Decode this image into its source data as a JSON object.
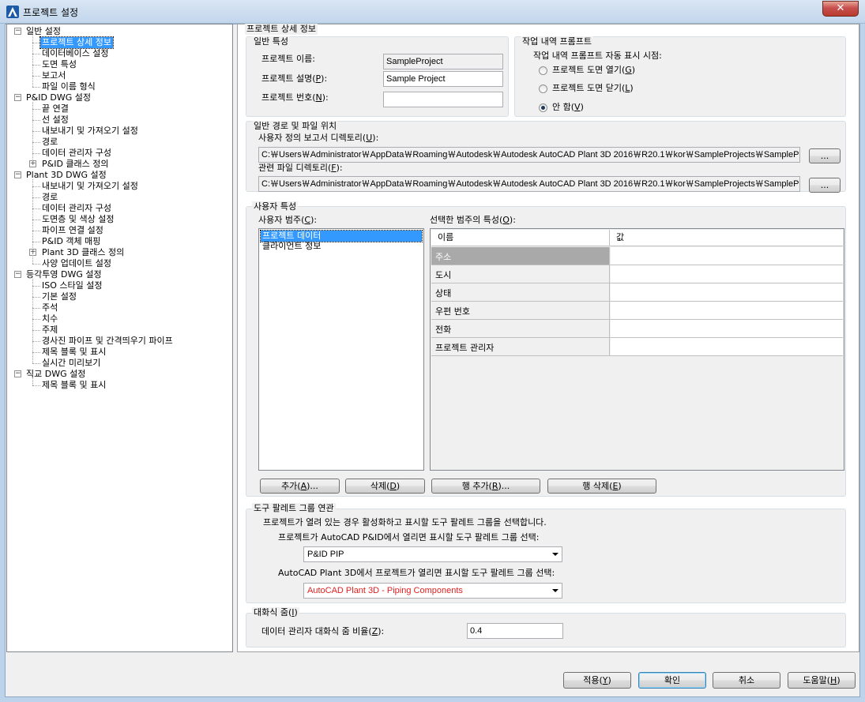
{
  "window": {
    "title": "프로젝트 설정",
    "close_label": "✕"
  },
  "tree": [
    {
      "label": "일반 설정",
      "level": 0,
      "expander": "minus"
    },
    {
      "label": "프로젝트 상세 정보",
      "level": 1,
      "selected": true
    },
    {
      "label": "데이터베이스 설정",
      "level": 1
    },
    {
      "label": "도면 특성",
      "level": 1
    },
    {
      "label": "보고서",
      "level": 1
    },
    {
      "label": "파일 이름 형식",
      "level": 1
    },
    {
      "label": "P&ID DWG 설정",
      "level": 0,
      "expander": "minus"
    },
    {
      "label": "끝 연결",
      "level": 1
    },
    {
      "label": "선 설정",
      "level": 1
    },
    {
      "label": "내보내기 및 가져오기 설정",
      "level": 1
    },
    {
      "label": "경로",
      "level": 1
    },
    {
      "label": "데이터 관리자 구성",
      "level": 1
    },
    {
      "label": "P&ID 클래스 정의",
      "level": 1,
      "expander": "plus"
    },
    {
      "label": "Plant 3D DWG 설정",
      "level": 0,
      "expander": "minus"
    },
    {
      "label": "내보내기 및 가져오기 설정",
      "level": 1
    },
    {
      "label": "경로",
      "level": 1
    },
    {
      "label": "데이터 관리자 구성",
      "level": 1
    },
    {
      "label": "도면층 및 색상 설정",
      "level": 1
    },
    {
      "label": "파이프 연결 설정",
      "level": 1
    },
    {
      "label": "P&ID 객체 매핑",
      "level": 1
    },
    {
      "label": "Plant 3D 클래스 정의",
      "level": 1,
      "expander": "plus"
    },
    {
      "label": "사양 업데이트 설정",
      "level": 1
    },
    {
      "label": "등각투영 DWG 설정",
      "level": 0,
      "expander": "minus"
    },
    {
      "label": "ISO 스타일 설정",
      "level": 1
    },
    {
      "label": "기본 설정",
      "level": 1
    },
    {
      "label": "주석",
      "level": 1
    },
    {
      "label": "치수",
      "level": 1
    },
    {
      "label": "주제",
      "level": 1
    },
    {
      "label": "경사진 파이프 및 간격띄우기 파이프",
      "level": 1
    },
    {
      "label": "제목 블록 및 표시",
      "level": 1
    },
    {
      "label": "실시간 미리보기",
      "level": 1
    },
    {
      "label": "직교 DWG 설정",
      "level": 0,
      "expander": "minus"
    },
    {
      "label": "제목 블록 및 표시",
      "level": 1
    }
  ],
  "panel": {
    "title": "프로젝트 상세 정보",
    "general": {
      "title": "일반 특성",
      "name_label": "프로젝트 이름:",
      "name_value": "SampleProject",
      "desc_label_pre": "프로젝트 설명(",
      "desc_key": "P",
      "desc_label_post": "):",
      "desc_value": "Sample Project",
      "num_label_pre": "프로젝트 번호(",
      "num_key": "N",
      "num_label_post": "):",
      "num_value": ""
    },
    "prompt": {
      "title": "작업 내역 프롬프트",
      "subtitle": "작업 내역 프롬프트 자동 표시 시점:",
      "opt1_pre": "프로젝트 도면 열기(",
      "opt1_key": "G",
      "opt1_post": ")",
      "opt2_pre": "프로젝트 도면 닫기(",
      "opt2_key": "L",
      "opt2_post": ")",
      "opt3_pre": "안 함(",
      "opt3_key": "V",
      "opt3_post": ")",
      "selected": 3
    },
    "paths": {
      "title": "일반 경로 및 파일 위치",
      "report_label_pre": "사용자 정의 보고서 디렉토리(",
      "report_key": "U",
      "report_label_post": "):",
      "report_value": "C:￦Users￦Administrator￦AppData￦Roaming￦Autodesk￦Autodesk AutoCAD Plant 3D 2016￦R20.1￦kor￦SampleProjects￦SampleProject",
      "related_label_pre": "관련 파일 디렉토리(",
      "related_key": "F",
      "related_label_post": "):",
      "related_value": "C:￦Users￦Administrator￦AppData￦Roaming￦Autodesk￦Autodesk AutoCAD Plant 3D 2016￦R20.1￦kor￦SampleProjects￦SampleProject",
      "browse_label": "..."
    },
    "user": {
      "title": "사용자 특성",
      "cat_label_pre": "사용자 범주(",
      "cat_key": "C",
      "cat_label_post": "):",
      "categories": [
        "프로젝트 데이터",
        "클라이언트 정보"
      ],
      "props_label_pre": "선택한 범주의 특성(",
      "props_key": "O",
      "props_label_post": "):",
      "col_name": "이름",
      "col_value": "값",
      "rows": [
        {
          "name": "주소",
          "value": ""
        },
        {
          "name": "도시",
          "value": ""
        },
        {
          "name": "상태",
          "value": ""
        },
        {
          "name": "우편 번호",
          "value": ""
        },
        {
          "name": "전화",
          "value": ""
        },
        {
          "name": "프로젝트 관리자",
          "value": ""
        }
      ],
      "add_pre": "추가(",
      "add_key": "A",
      "add_post": ")...",
      "del_pre": "삭제(",
      "del_key": "D",
      "del_post": ")",
      "addrow_pre": "행 추가(",
      "addrow_key": "R",
      "addrow_post": ")...",
      "delrow_pre": "행 삭제(",
      "delrow_key": "E",
      "delrow_post": ")"
    },
    "palette": {
      "title": "도구 팔레트 그룹 연관",
      "desc": "프로젝트가 열려 있는 경우 활성화하고 표시할 도구 팔레트 그룹을 선택합니다.",
      "pid_label": "프로젝트가 AutoCAD P&ID에서 열리면 표시할 도구 팔레트 그룹 선택:",
      "pid_value": "P&ID PIP",
      "plant_label": "AutoCAD Plant 3D에서 프로젝트가 열리면 표시할 도구 팔레트 그룹 선택:",
      "plant_value": "AutoCAD Plant 3D - Piping Components",
      "plant_color": "#e02020"
    },
    "zoom": {
      "title_pre": "대화식 줌(",
      "title_key": "I",
      "title_post": ")",
      "label_pre": "데이터 관리자 대화식 줌 비율(",
      "label_key": "Z",
      "label_post": "):",
      "value": "0.4"
    }
  },
  "footer": {
    "apply_pre": "적용(",
    "apply_key": "Y",
    "apply_post": ")",
    "ok": "확인",
    "cancel": "취소",
    "help_pre": "도움말(",
    "help_key": "H",
    "help_post": ")"
  }
}
